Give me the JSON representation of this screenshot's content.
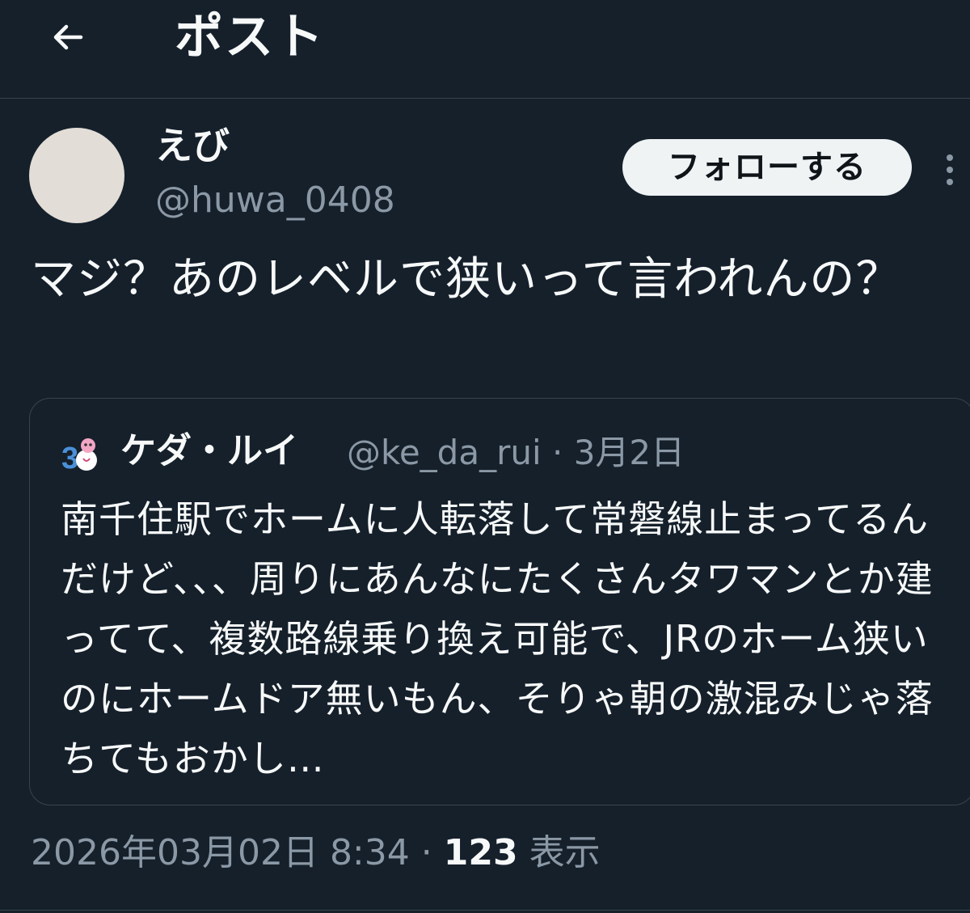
{
  "header": {
    "title": "ポスト",
    "back_icon": "arrow-left-icon"
  },
  "author": {
    "display_name": "えび",
    "handle": "@huwa_0408",
    "avatar_color": "#e2ddd6"
  },
  "follow_button": {
    "label": "フォローする"
  },
  "more_icon": "vertical-ellipsis-icon",
  "post": {
    "text": "マジ？あのレベルで狭いって言われんの？"
  },
  "quote": {
    "avatar_icon": "anniversary-30-mascot-icon",
    "display_name": "ケダ・ルイ",
    "handle": "@ke_da_rui",
    "separator": " · ",
    "date": "3月2日",
    "text": "南千住駅でホームに人転落して常磐線止まってるんだけど、、、周りにあんなにたくさんタワマンとか建ってて、複数路線乗り換え可能で、JRのホーム狭いのにホームドア無いもん、そりゃ朝の激混みじゃ落ちてもおかし…"
  },
  "meta": {
    "timestamp": "2026年03月02日 8:34",
    "separator": " · ",
    "views_count": "123",
    "views_label": " 表示"
  },
  "colors": {
    "background": "#15202b",
    "border": "#38444d",
    "text_primary": "#f7f9f9",
    "text_secondary": "#8b98a5",
    "follow_bg": "#eff3f4",
    "follow_text": "#0f1419"
  }
}
